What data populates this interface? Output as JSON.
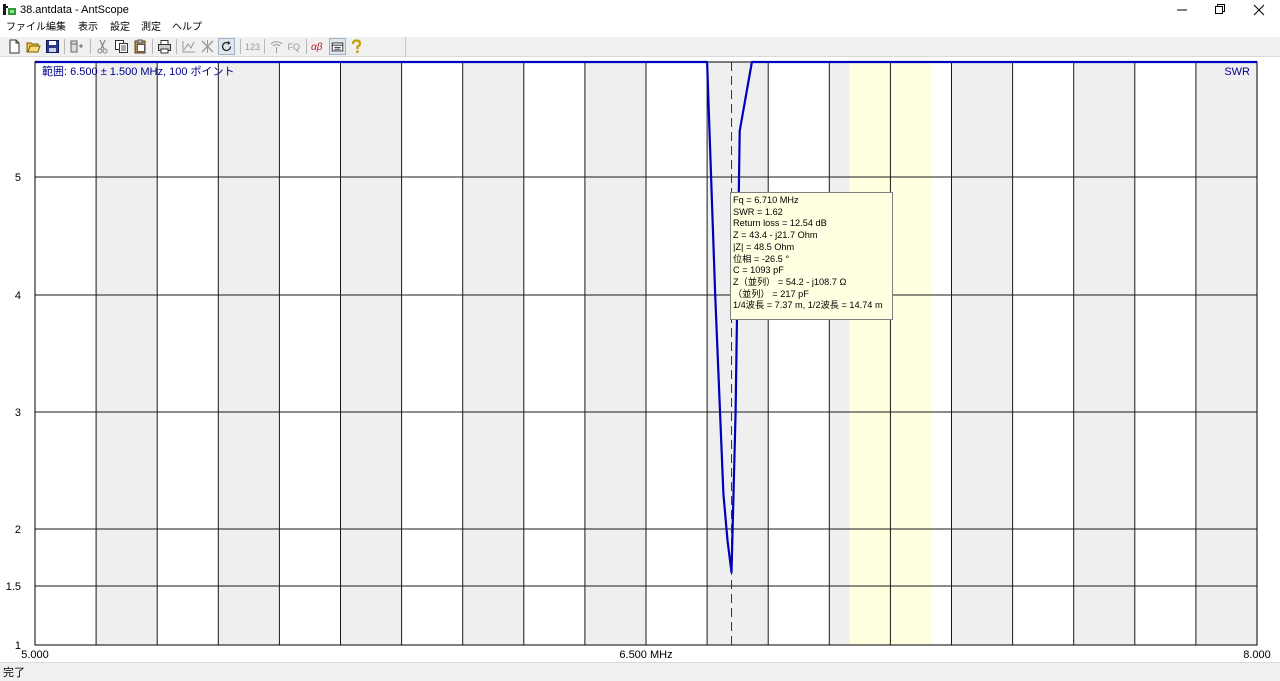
{
  "window": {
    "title": "38.antdata - AntScope",
    "minimize_glyph": "—",
    "restore_glyph": "❐",
    "close_glyph": "✕"
  },
  "menu": {
    "items": [
      "ファイル",
      "編集",
      "表示",
      "設定",
      "測定",
      "ヘルプ"
    ]
  },
  "toolbar": {
    "icons": [
      "new-file-icon",
      "open-folder-icon",
      "save-disk-icon",
      "add-marker-icon",
      "cut-icon",
      "copy-icon",
      "paste-icon",
      "print-icon",
      "graph-icon",
      "clear-marker-icon",
      "refresh-icon",
      "numeric-123-icon",
      "antenna-icon",
      "fq-icon",
      "alpha-beta-icon",
      "panel-icon",
      "help-icon"
    ],
    "numeric_label": "123",
    "fq_label": "FQ",
    "alpha_label": "αβ"
  },
  "status": {
    "text": "完了"
  },
  "chart_data": {
    "type": "line",
    "range_label": "範囲: 6.500 ± 1.500 MHz, 100 ポイント",
    "series_label": "SWR",
    "x_ticks": [
      "5.000",
      "6.500 MHz",
      "8.000"
    ],
    "y_ticks": [
      "5",
      "4",
      "3",
      "2",
      "1.5",
      "1"
    ],
    "xlim": [
      5.0,
      8.0
    ],
    "ylim": [
      1,
      6
    ],
    "grid": true,
    "band_highlight_mhz": [
      7.0,
      7.2
    ],
    "series": [
      {
        "name": "SWR",
        "color": "#0000bb",
        "x": [
          5.0,
          6.65,
          6.67,
          6.69,
          6.7,
          6.71,
          6.72,
          6.73,
          6.76,
          8.0
        ],
        "y": [
          6.0,
          6.0,
          4.0,
          2.3,
          1.9,
          1.62,
          3.0,
          5.4,
          6.0,
          6.0
        ]
      }
    ],
    "cursor_mhz": 6.71,
    "tooltip": [
      "Fq = 6.710 MHz",
      "SWR = 1.62",
      "Return loss = 12.54 dB",
      "Z = 43.4 - j21.7 Ohm",
      "|Z| = 48.5 Ohm",
      "位相 = -26.5 °",
      "C = 1093 pF",
      "Z（並列） = 54.2 - j108.7 Ω",
      "（並列） = 217 pF",
      "1/4波長 = 7.37 m, 1/2波長 = 14.74 m"
    ]
  }
}
